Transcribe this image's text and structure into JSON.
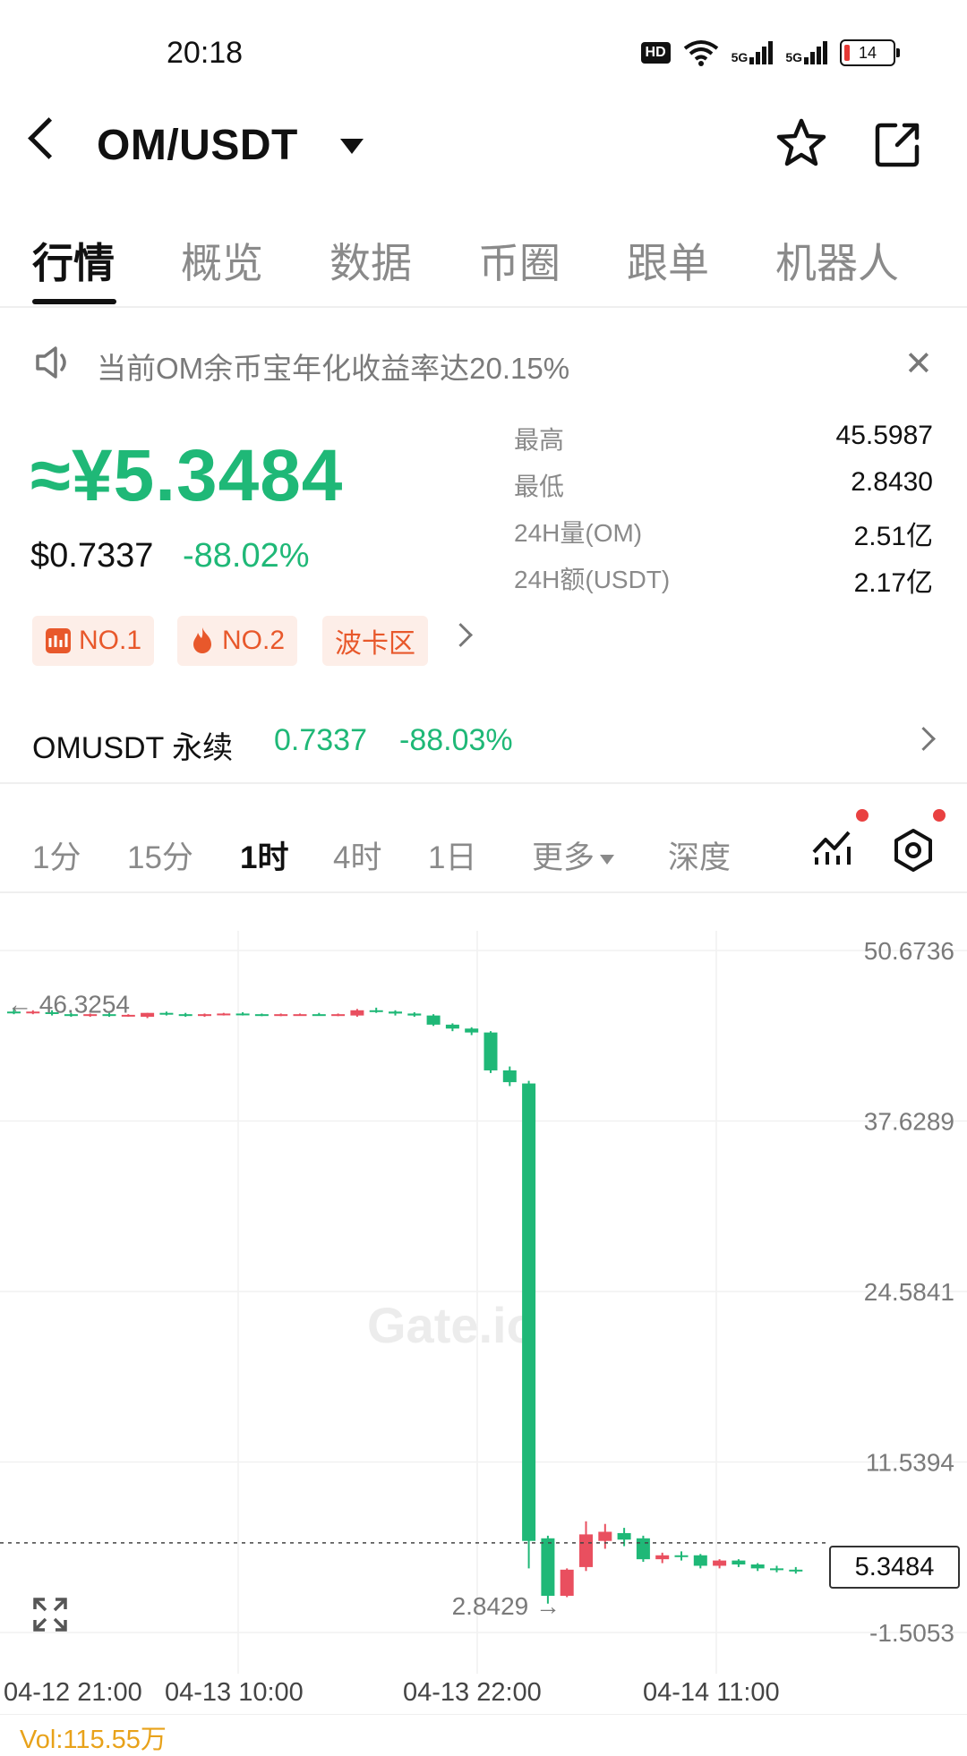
{
  "status_bar": {
    "time": "20:18",
    "hd": "HD",
    "net1": "5G",
    "net2": "5G",
    "battery": "14"
  },
  "header": {
    "pair": "OM/USDT",
    "icons": [
      "back-icon",
      "dropdown-caret-icon",
      "star-icon",
      "share-icon"
    ]
  },
  "tabs": [
    "行情",
    "概览",
    "数据",
    "币圈",
    "跟单",
    "机器人"
  ],
  "notice": {
    "text": "当前OM余币宝年化收益率达20.15%"
  },
  "price": {
    "cny": "≈¥5.3484",
    "usd": "$0.7337",
    "change": "-88.02%"
  },
  "stats": [
    {
      "label": "最高",
      "value": "45.5987"
    },
    {
      "label": "最低",
      "value": "2.8430"
    },
    {
      "label": "24H量(OM)",
      "value": "2.51亿"
    },
    {
      "label": "24H额(USDT)",
      "value": "2.17亿"
    }
  ],
  "badges": [
    "NO.1",
    "NO.2",
    "波卡区"
  ],
  "perpetual": {
    "name": "OMUSDT 永续",
    "price": "0.7337",
    "change": "-88.03%"
  },
  "intervals": [
    "1分",
    "15分",
    "1时",
    "4时",
    "1日",
    "更多",
    "深度"
  ],
  "chart_data": {
    "type": "candlestick",
    "y_ticks": [
      "50.6736",
      "37.6289",
      "24.5841",
      "11.5394",
      "-1.5053"
    ],
    "x_ticks": [
      "04-12 21:00",
      "04-13 10:00",
      "04-13 22:00",
      "04-14 11:00"
    ],
    "ylim": [
      -1.5053,
      50.6736
    ],
    "high_marker": "← 46.3254",
    "low_marker": "2.8429 →",
    "current_price": "5.3484",
    "volume_label": "Vol:115.55万",
    "watermark": "Gate.io",
    "colors": {
      "up": "#e94f5f",
      "down": "#1fb877"
    },
    "candles": [
      {
        "o": 46.0,
        "h": 46.3,
        "c": 45.95,
        "l": 45.8
      },
      {
        "o": 45.9,
        "h": 46.1,
        "c": 46.0,
        "l": 45.8
      },
      {
        "o": 45.95,
        "h": 46.1,
        "c": 45.85,
        "l": 45.7
      },
      {
        "o": 45.8,
        "h": 45.9,
        "c": 45.75,
        "l": 45.6
      },
      {
        "o": 45.7,
        "h": 45.85,
        "c": 45.8,
        "l": 45.6
      },
      {
        "o": 45.8,
        "h": 45.9,
        "c": 45.7,
        "l": 45.6
      },
      {
        "o": 45.7,
        "h": 45.8,
        "c": 45.75,
        "l": 45.6
      },
      {
        "o": 45.6,
        "h": 45.9,
        "c": 45.9,
        "l": 45.5
      },
      {
        "o": 45.9,
        "h": 46.0,
        "c": 45.85,
        "l": 45.7
      },
      {
        "o": 45.8,
        "h": 45.9,
        "c": 45.75,
        "l": 45.6
      },
      {
        "o": 45.7,
        "h": 45.85,
        "c": 45.8,
        "l": 45.6
      },
      {
        "o": 45.8,
        "h": 45.9,
        "c": 45.85,
        "l": 45.7
      },
      {
        "o": 45.85,
        "h": 45.95,
        "c": 45.8,
        "l": 45.7
      },
      {
        "o": 45.8,
        "h": 45.85,
        "c": 45.75,
        "l": 45.65
      },
      {
        "o": 45.75,
        "h": 45.85,
        "c": 45.8,
        "l": 45.65
      },
      {
        "o": 45.75,
        "h": 45.85,
        "c": 45.8,
        "l": 45.7
      },
      {
        "o": 45.8,
        "h": 45.9,
        "c": 45.75,
        "l": 45.7
      },
      {
        "o": 45.75,
        "h": 45.85,
        "c": 45.8,
        "l": 45.65
      },
      {
        "o": 45.7,
        "h": 46.2,
        "c": 46.1,
        "l": 45.6
      },
      {
        "o": 46.1,
        "h": 46.3,
        "c": 46.0,
        "l": 45.9
      },
      {
        "o": 46.0,
        "h": 46.1,
        "c": 45.85,
        "l": 45.7
      },
      {
        "o": 45.85,
        "h": 45.95,
        "c": 45.7,
        "l": 45.6
      },
      {
        "o": 45.7,
        "h": 45.8,
        "c": 45.0,
        "l": 44.9
      },
      {
        "o": 45.0,
        "h": 45.1,
        "c": 44.7,
        "l": 44.5
      },
      {
        "o": 44.7,
        "h": 44.8,
        "c": 44.4,
        "l": 44.2
      },
      {
        "o": 44.4,
        "h": 44.5,
        "c": 41.5,
        "l": 41.3
      },
      {
        "o": 41.5,
        "h": 41.8,
        "c": 40.6,
        "l": 40.3
      },
      {
        "o": 40.5,
        "h": 40.7,
        "c": 5.5,
        "l": 3.4
      },
      {
        "o": 5.7,
        "h": 5.9,
        "c": 1.3,
        "l": 0.7
      },
      {
        "o": 1.3,
        "h": 3.4,
        "c": 3.3,
        "l": 1.2
      },
      {
        "o": 3.5,
        "h": 7.0,
        "c": 6.0,
        "l": 3.2
      },
      {
        "o": 5.5,
        "h": 6.8,
        "c": 6.2,
        "l": 4.9
      },
      {
        "o": 6.1,
        "h": 6.5,
        "c": 5.6,
        "l": 5.1
      },
      {
        "o": 5.7,
        "h": 5.9,
        "c": 4.1,
        "l": 3.9
      },
      {
        "o": 4.1,
        "h": 4.6,
        "c": 4.4,
        "l": 3.8
      },
      {
        "o": 4.4,
        "h": 4.7,
        "c": 4.3,
        "l": 4.0
      },
      {
        "o": 4.4,
        "h": 4.5,
        "c": 3.6,
        "l": 3.4
      },
      {
        "o": 3.6,
        "h": 4.1,
        "c": 4.0,
        "l": 3.4
      },
      {
        "o": 4.0,
        "h": 4.1,
        "c": 3.7,
        "l": 3.5
      },
      {
        "o": 3.7,
        "h": 3.8,
        "c": 3.4,
        "l": 3.2
      },
      {
        "o": 3.4,
        "h": 3.6,
        "c": 3.3,
        "l": 3.1
      },
      {
        "o": 3.3,
        "h": 3.5,
        "c": 3.2,
        "l": 3.0
      }
    ]
  }
}
